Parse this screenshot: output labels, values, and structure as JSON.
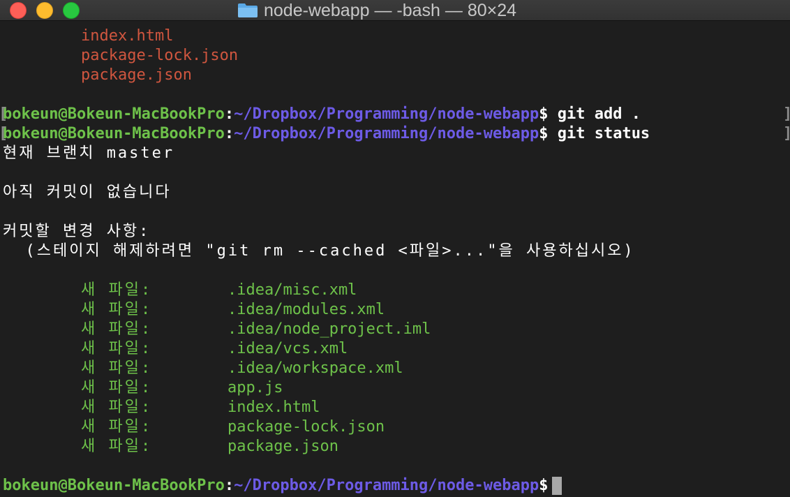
{
  "window": {
    "title": "node-webapp — -bash — 80×24",
    "folder_icon": "folder-icon"
  },
  "colors": {
    "background": "#1e1e1e",
    "red_file": "#d0563f",
    "green": "#6ec24a",
    "path": "#6d5be6",
    "cursor": "#a8a8a8"
  },
  "top_files": [
    "index.html",
    "package-lock.json",
    "package.json"
  ],
  "prompt": {
    "host": "bokeun@Bokeun-MacBookPro",
    "colon": ":",
    "path": "~/Dropbox/Programming/node-webapp",
    "dollar": "$"
  },
  "commands": [
    " git add .",
    " git status"
  ],
  "status": {
    "branch": "현재 브랜치 master",
    "no_commits": "아직 커밋이 없습니다",
    "to_commit": "커밋할 변경 사항:",
    "hint": "  (스테이지 해제하려면 \"git rm --cached <파일>...\"을 사용하십시오)",
    "staged_label": "새 파일:",
    "staged_files": [
      ".idea/misc.xml",
      ".idea/modules.xml",
      ".idea/node_project.iml",
      ".idea/vcs.xml",
      ".idea/workspace.xml",
      "app.js",
      "index.html",
      "package-lock.json",
      "package.json"
    ]
  },
  "brackets": {
    "open": "[",
    "close": "]"
  }
}
